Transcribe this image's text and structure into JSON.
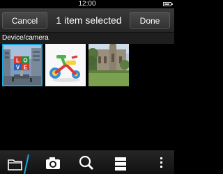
{
  "status_bar": {
    "time": "12:00"
  },
  "title_bar": {
    "cancel_label": "Cancel",
    "title": "1 item selected",
    "done_label": "Done"
  },
  "section": {
    "label": "Device/camera"
  },
  "thumbnails": [
    {
      "subject": "love-sculpture",
      "selected": true
    },
    {
      "subject": "tricycle-toy",
      "selected": false
    },
    {
      "subject": "cathedral",
      "selected": false
    }
  ],
  "bottom_bar": {
    "items": [
      {
        "icon": "folder-icon"
      },
      {
        "icon": "camera-icon"
      },
      {
        "icon": "search-icon"
      },
      {
        "icon": "list-view-icon"
      },
      {
        "icon": "overflow-menu-icon"
      }
    ]
  },
  "colors": {
    "selection_accent": "#1aa5dc",
    "background": "#000000"
  }
}
